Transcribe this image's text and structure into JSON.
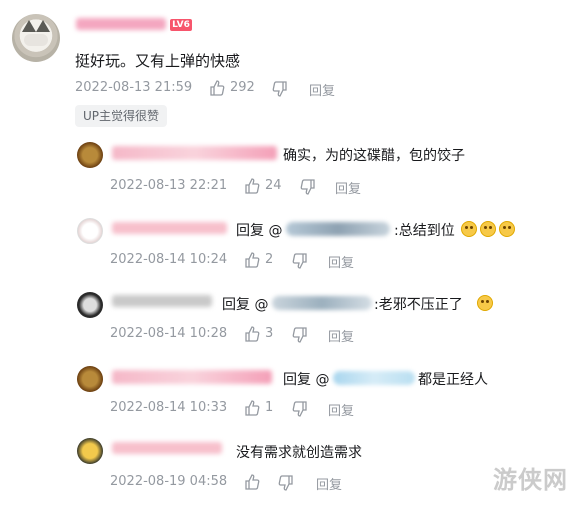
{
  "main_comment": {
    "level_badge": "LV6",
    "text": "挺好玩。又有上弹的快感",
    "timestamp": "2022-08-13 21:59",
    "likes": "292",
    "reply_label": "回复",
    "tag": "UP主觉得很赞"
  },
  "replies": [
    {
      "prefix": "",
      "text": "确实，为的这碟醋，包的饺子",
      "timestamp": "2022-08-13 22:21",
      "likes": "24",
      "reply_label": "回复"
    },
    {
      "prefix": "回复 @",
      "text": ":总结到位",
      "timestamp": "2022-08-14 10:24",
      "likes": "2",
      "reply_label": "回复"
    },
    {
      "prefix": "回复 @",
      "text": ":老邪不压正了",
      "timestamp": "2022-08-14 10:28",
      "likes": "3",
      "reply_label": "回复"
    },
    {
      "prefix": "回复 @",
      "text": "都是正经人",
      "timestamp": "2022-08-14 10:33",
      "likes": "1",
      "reply_label": "回复"
    },
    {
      "prefix": "",
      "text": "没有需求就创造需求",
      "timestamp": "2022-08-19 04:58",
      "likes": "",
      "reply_label": "回复"
    }
  ],
  "watermark": "游侠网",
  "colors": {
    "meta": "#9499a0",
    "level": "#f7556c",
    "text": "#18191c"
  }
}
